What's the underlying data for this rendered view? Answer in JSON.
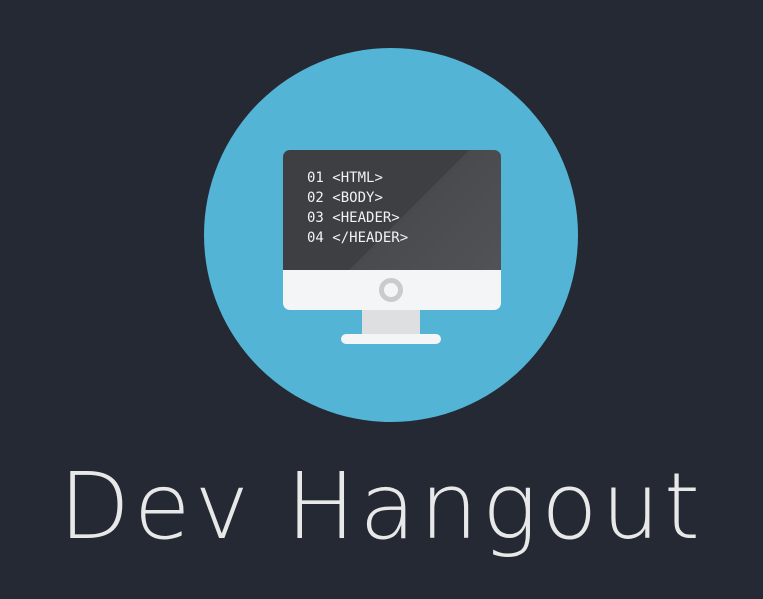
{
  "logo": {
    "icon": "monitor-code-icon",
    "circle_color": "#53b4d6",
    "screen_color": "#3d3f42",
    "code_lines": [
      {
        "line_no": "01",
        "code": "<HTML>"
      },
      {
        "line_no": "02",
        "code": "<BODY>"
      },
      {
        "line_no": "03",
        "code": "<HEADER>"
      },
      {
        "line_no": "04",
        "code": "</HEADER>"
      }
    ]
  },
  "title": "Dev Hangout",
  "colors": {
    "background": "#242933",
    "title": "#e8e8e8"
  }
}
